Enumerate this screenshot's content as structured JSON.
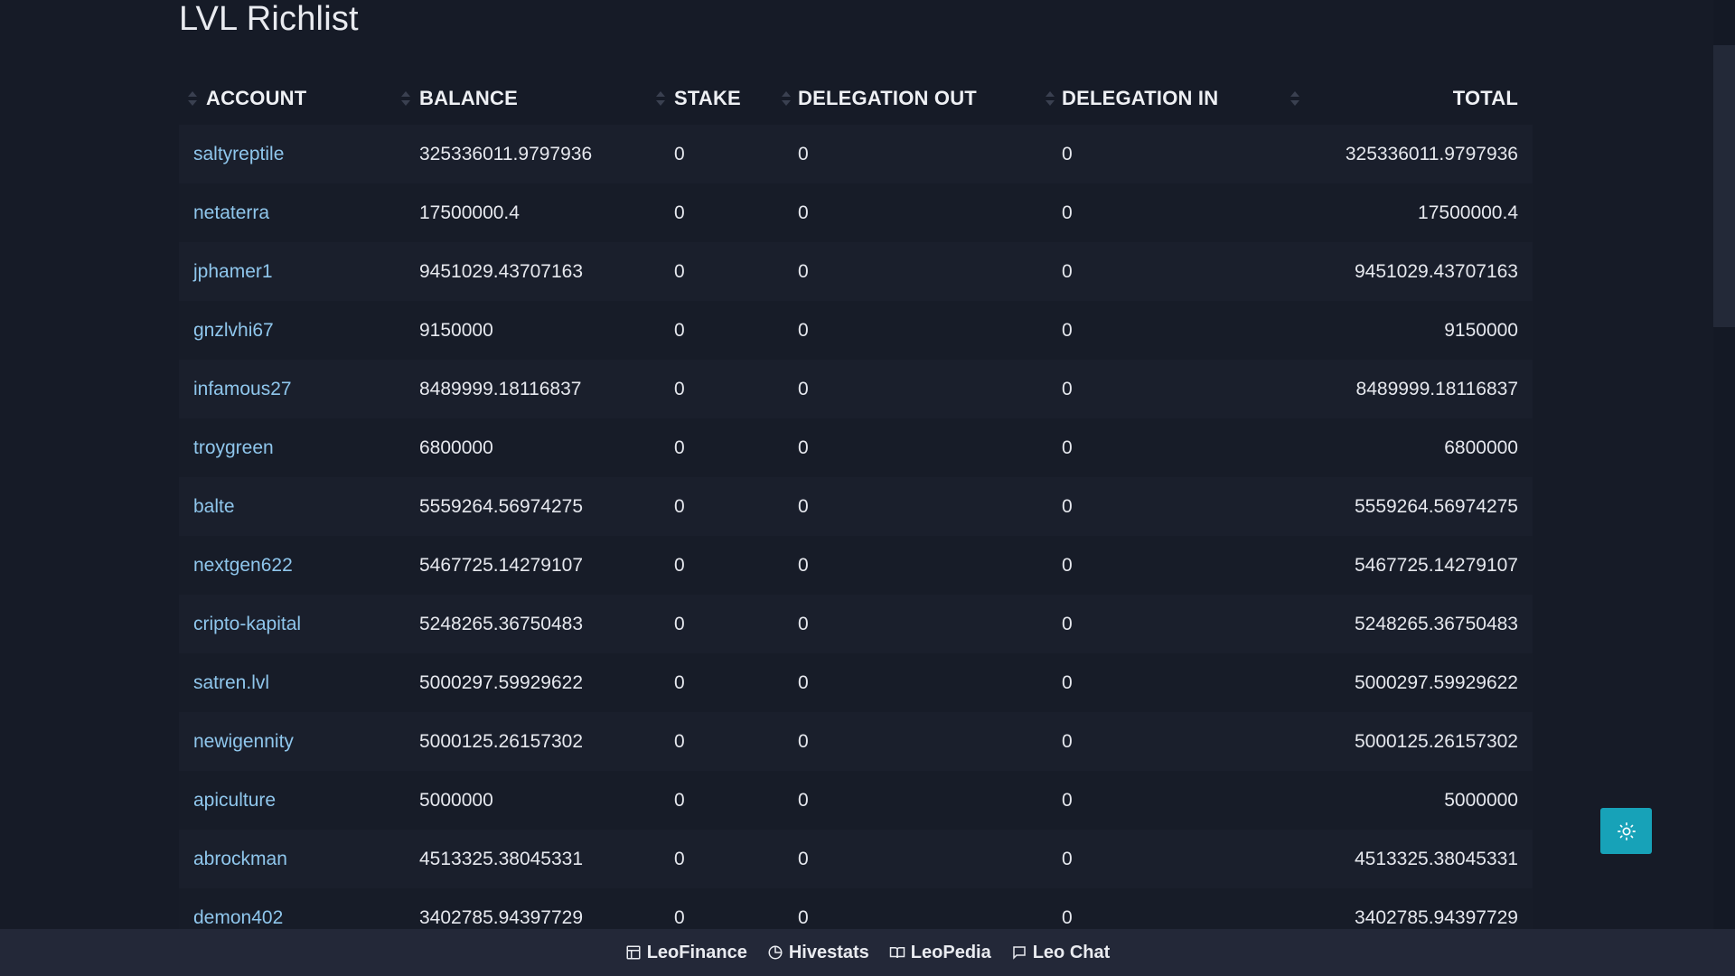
{
  "page": {
    "title": "LVL Richlist"
  },
  "table": {
    "headers": {
      "account": "ACCOUNT",
      "balance": "BALANCE",
      "stake": "STAKE",
      "delegation_out": "DELEGATION OUT",
      "delegation_in": "DELEGATION IN",
      "total": "TOTAL"
    },
    "rows": [
      {
        "account": "saltyreptile",
        "balance": "325336011.9797936",
        "stake": "0",
        "delegation_out": "0",
        "delegation_in": "0",
        "total": "325336011.9797936"
      },
      {
        "account": "netaterra",
        "balance": "17500000.4",
        "stake": "0",
        "delegation_out": "0",
        "delegation_in": "0",
        "total": "17500000.4"
      },
      {
        "account": "jphamer1",
        "balance": "9451029.43707163",
        "stake": "0",
        "delegation_out": "0",
        "delegation_in": "0",
        "total": "9451029.43707163"
      },
      {
        "account": "gnzlvhi67",
        "balance": "9150000",
        "stake": "0",
        "delegation_out": "0",
        "delegation_in": "0",
        "total": "9150000"
      },
      {
        "account": "infamous27",
        "balance": "8489999.18116837",
        "stake": "0",
        "delegation_out": "0",
        "delegation_in": "0",
        "total": "8489999.18116837"
      },
      {
        "account": "troygreen",
        "balance": "6800000",
        "stake": "0",
        "delegation_out": "0",
        "delegation_in": "0",
        "total": "6800000"
      },
      {
        "account": "balte",
        "balance": "5559264.56974275",
        "stake": "0",
        "delegation_out": "0",
        "delegation_in": "0",
        "total": "5559264.56974275"
      },
      {
        "account": "nextgen622",
        "balance": "5467725.14279107",
        "stake": "0",
        "delegation_out": "0",
        "delegation_in": "0",
        "total": "5467725.14279107"
      },
      {
        "account": "cripto-kapital",
        "balance": "5248265.36750483",
        "stake": "0",
        "delegation_out": "0",
        "delegation_in": "0",
        "total": "5248265.36750483"
      },
      {
        "account": "satren.lvl",
        "balance": "5000297.59929622",
        "stake": "0",
        "delegation_out": "0",
        "delegation_in": "0",
        "total": "5000297.59929622"
      },
      {
        "account": "newigennity",
        "balance": "5000125.26157302",
        "stake": "0",
        "delegation_out": "0",
        "delegation_in": "0",
        "total": "5000125.26157302"
      },
      {
        "account": "apiculture",
        "balance": "5000000",
        "stake": "0",
        "delegation_out": "0",
        "delegation_in": "0",
        "total": "5000000"
      },
      {
        "account": "abrockman",
        "balance": "4513325.38045331",
        "stake": "0",
        "delegation_out": "0",
        "delegation_in": "0",
        "total": "4513325.38045331"
      },
      {
        "account": "demon402",
        "balance": "3402785.94397729",
        "stake": "0",
        "delegation_out": "0",
        "delegation_in": "0",
        "total": "3402785.94397729"
      }
    ]
  },
  "theme_toggle": {
    "icon": "sun-icon"
  },
  "footer": {
    "links": [
      {
        "label": "LeoFinance",
        "icon": "layout-icon"
      },
      {
        "label": "Hivestats",
        "icon": "pie-chart-icon"
      },
      {
        "label": "LeoPedia",
        "icon": "book-icon"
      },
      {
        "label": "Leo Chat",
        "icon": "chat-icon"
      }
    ]
  },
  "colors": {
    "background": "#161b27",
    "link": "#8fc6ec",
    "accent": "#17a2b8",
    "footer": "#232838"
  }
}
